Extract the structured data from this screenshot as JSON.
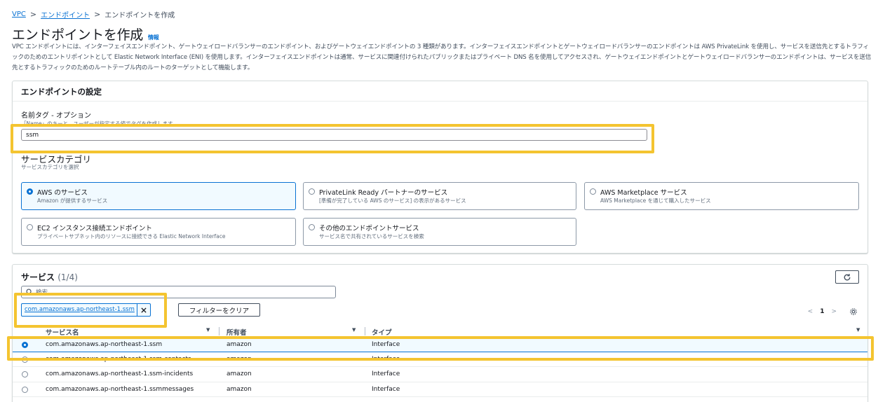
{
  "breadcrumb": {
    "items": [
      "VPC",
      "エンドポイント"
    ],
    "current": "エンドポイントを作成"
  },
  "page": {
    "title": "エンドポイントを作成",
    "info_link": "情報",
    "description": "VPC エンドポイントには、インターフェイスエンドポイント、ゲートウェイロードバランサーのエンドポイント、およびゲートウェイエンドポイントの 3 種類があります。インターフェイスエンドポイントとゲートウェイロードバランサーのエンドポイントは AWS PrivateLink を使用し、サービスを送信先とするトラフィックのためのエントリポイントとして Elastic Network Interface (ENI) を使用します。インターフェイスエンドポイントは通常、サービスに関連付けられたパブリックまたはプライベート DNS 名を使用してアクセスされ、ゲートウェイエンドポイントとゲートウェイロードバランサーのエンドポイントは、サービスを送信先とするトラフィックのためのルートテーブル内のルートのターゲットとして機能します。"
  },
  "settings": {
    "header": "エンドポイントの設定",
    "name_tag": {
      "label": "名前タグ - オプション",
      "description": "「Name」のキーと、ユーザーが指定する値でタグを作成します。",
      "value": "ssm"
    },
    "category": {
      "label": "サービスカテゴリ",
      "description": "サービスカテゴリを選択",
      "options": [
        {
          "title": "AWS のサービス",
          "desc": "Amazon が提供するサービス",
          "selected": true
        },
        {
          "title": "PrivateLink Ready パートナーのサービス",
          "desc": "[準備が完了している AWS のサービス] の表示があるサービス",
          "selected": false
        },
        {
          "title": "AWS Marketplace サービス",
          "desc": "AWS Marketplace を通じて購入したサービス",
          "selected": false
        },
        {
          "title": "EC2 インスタンス接続エンドポイント",
          "desc": "プライベートサブネット内のリソースに接続できる Elastic Network Interface",
          "selected": false
        },
        {
          "title": "その他のエンドポイントサービス",
          "desc": "サービス名で共有されているサービスを検索",
          "selected": false
        }
      ]
    }
  },
  "services": {
    "title": "サービス",
    "count": "(1/4)",
    "search_placeholder": "検索",
    "filter_token": "com.amazonaws.ap-northeast-1.ssm",
    "clear_filter_label": "フィルターをクリア",
    "page_number": "1",
    "columns": [
      "サービス名",
      "所有者",
      "タイプ"
    ],
    "rows": [
      {
        "name": "com.amazonaws.ap-northeast-1.ssm",
        "owner": "amazon",
        "type": "Interface",
        "selected": true
      },
      {
        "name": "com.amazonaws.ap-northeast-1.ssm-contacts",
        "owner": "amazon",
        "type": "Interface",
        "selected": false
      },
      {
        "name": "com.amazonaws.ap-northeast-1.ssm-incidents",
        "owner": "amazon",
        "type": "Interface",
        "selected": false
      },
      {
        "name": "com.amazonaws.ap-northeast-1.ssmmessages",
        "owner": "amazon",
        "type": "Interface",
        "selected": false
      }
    ]
  },
  "colors": {
    "link": "#0972d3",
    "highlight": "#f4c430",
    "border": "#d5dbdb",
    "selected_bg": "#f1faff"
  },
  "icons": [
    "chevron-right-icon",
    "search-icon",
    "close-icon",
    "refresh-icon",
    "chevron-left-icon",
    "settings-gear-icon",
    "sort-down-icon"
  ]
}
